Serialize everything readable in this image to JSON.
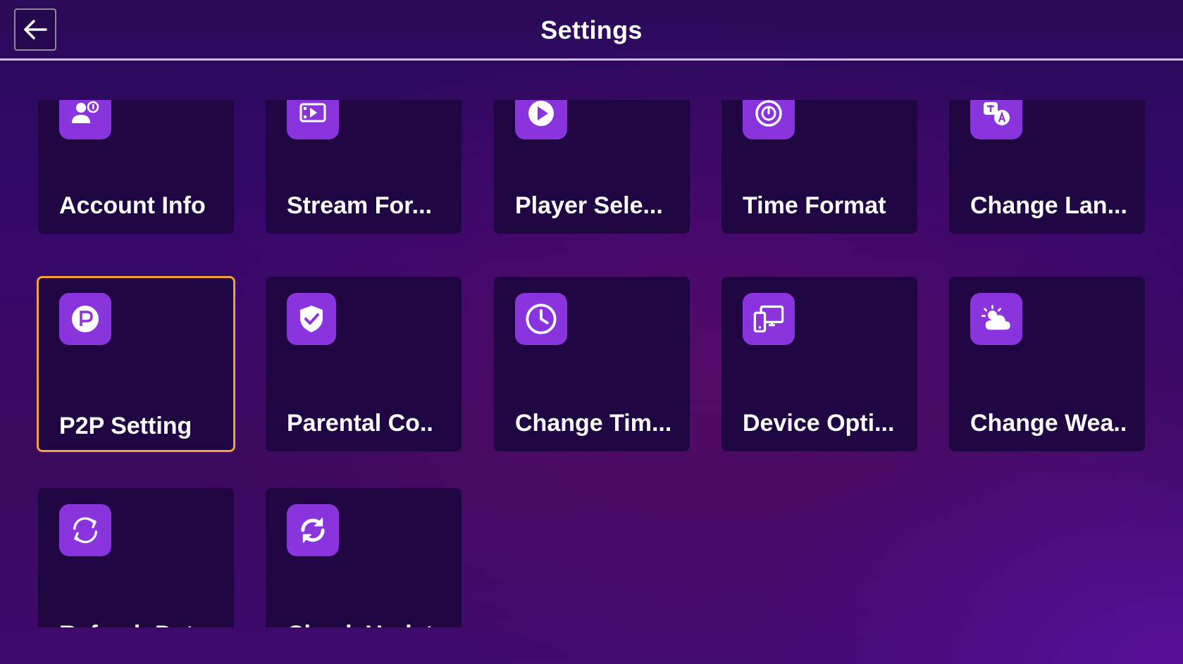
{
  "header": {
    "title": "Settings",
    "back_icon": "arrow-left-icon"
  },
  "colors": {
    "tile_bg": "#1f0642",
    "icon_bg": "#8a34dd",
    "focus_border": "#f2a03a",
    "divider": "#c9c3d8"
  },
  "tiles": [
    {
      "label": "Account Info",
      "icon": "account-icon"
    },
    {
      "label": "Stream For...",
      "icon": "stream-format-icon"
    },
    {
      "label": "Player Sele...",
      "icon": "play-icon"
    },
    {
      "label": "Time Format",
      "icon": "timer-icon"
    },
    {
      "label": "Change Lan...",
      "icon": "translate-icon"
    },
    {
      "label": "P2P Setting",
      "icon": "p2p-icon",
      "focused": true
    },
    {
      "label": "Parental Co..",
      "icon": "shield-check-icon"
    },
    {
      "label": "Change Tim...",
      "icon": "clock-icon"
    },
    {
      "label": "Device Opti...",
      "icon": "devices-icon"
    },
    {
      "label": "Change Wea..",
      "icon": "weather-icon"
    },
    {
      "label": "Refresh Dat...",
      "icon": "refresh-icon"
    },
    {
      "label": "Check Updat...",
      "icon": "sync-icon"
    }
  ]
}
